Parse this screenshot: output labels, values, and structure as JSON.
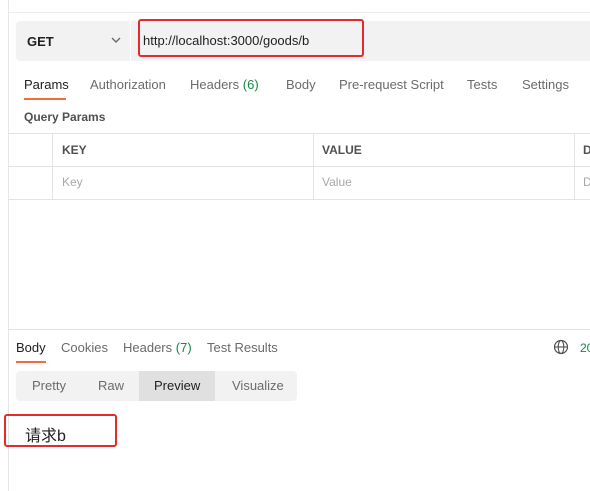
{
  "request": {
    "method": "GET",
    "url": "http://localhost:3000/goods/b"
  },
  "request_tabs": [
    {
      "label": "Params"
    },
    {
      "label": "Authorization"
    },
    {
      "label": "Headers",
      "count": "(6)"
    },
    {
      "label": "Body"
    },
    {
      "label": "Pre-request Script"
    },
    {
      "label": "Tests"
    },
    {
      "label": "Settings"
    }
  ],
  "query_params": {
    "title": "Query Params",
    "headers": [
      "KEY",
      "VALUE",
      "D"
    ],
    "placeholders": [
      "Key",
      "Value",
      "D"
    ]
  },
  "response_tabs": [
    {
      "label": "Body"
    },
    {
      "label": "Cookies"
    },
    {
      "label": "Headers",
      "count": "(7)"
    },
    {
      "label": "Test Results"
    }
  ],
  "response_status_fragment": "20",
  "view_modes": [
    "Pretty",
    "Raw",
    "Preview",
    "Visualize"
  ],
  "active_view_mode": "Preview",
  "response_body": "请求b",
  "colors": {
    "accent": "#f26b3a",
    "highlight": "#e32b2b",
    "count_green": "#0f8a44"
  },
  "icons": [
    "chevron-down-icon",
    "globe-icon"
  ]
}
